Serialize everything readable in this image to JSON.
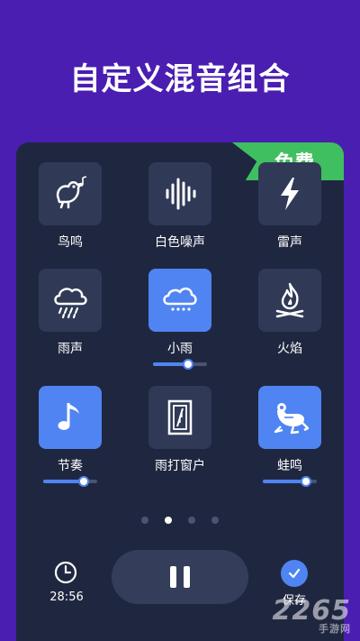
{
  "hero": {
    "title": "自定义混音组合"
  },
  "badge": {
    "label": "免费"
  },
  "sounds": [
    {
      "label": "鸟鸣",
      "icon": "bird-icon",
      "active": false
    },
    {
      "label": "白色噪声",
      "icon": "soundwave-icon",
      "active": false
    },
    {
      "label": "雷声",
      "icon": "lightning-icon",
      "active": false
    },
    {
      "label": "雨声",
      "icon": "rain-cloud-icon",
      "active": false
    },
    {
      "label": "小雨",
      "icon": "light-rain-icon",
      "active": true,
      "volume": 0.65
    },
    {
      "label": "火焰",
      "icon": "campfire-icon",
      "active": false
    },
    {
      "label": "节奏",
      "icon": "music-note-icon",
      "active": true,
      "volume": 0.75
    },
    {
      "label": "雨打窗户",
      "icon": "window-rain-icon",
      "active": false
    },
    {
      "label": "蛙鸣",
      "icon": "frog-icon",
      "active": true,
      "volume": 0.8
    }
  ],
  "pagination": {
    "count": 4,
    "current": 1
  },
  "controls": {
    "timer": "28:56",
    "save": "保存"
  },
  "watermark": {
    "brand": "2265",
    "sub": "手游网"
  },
  "colors": {
    "background": "#4a1eb0",
    "panel": "#1f2740",
    "accent": "#4f84f2",
    "badge": "#3fbf5f"
  }
}
